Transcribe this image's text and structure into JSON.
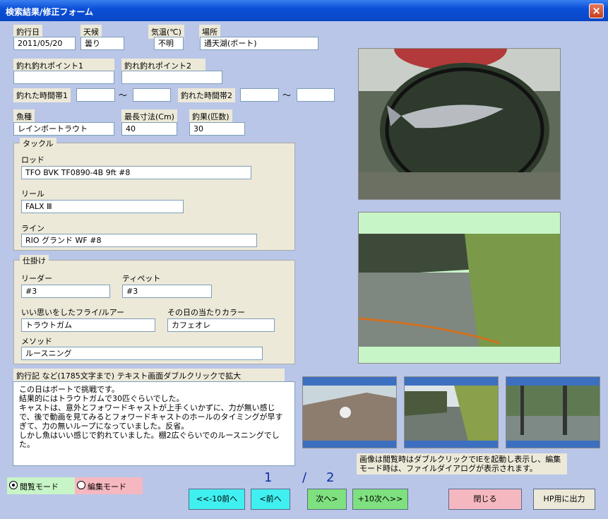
{
  "window": {
    "title": "検索結果/修正フォーム",
    "close_label": "×"
  },
  "fields": {
    "date": {
      "label": "釣行日",
      "value": "2011/05/20"
    },
    "weather": {
      "label": "天候",
      "value": "曇り"
    },
    "temp": {
      "label": "気温(℃)",
      "value": "不明"
    },
    "place": {
      "label": "場所",
      "value": "通天湖(ボート)"
    },
    "point1": {
      "label": "釣れ釣れポイント1",
      "value": ""
    },
    "point2": {
      "label": "釣れ釣れポイント2",
      "value": ""
    },
    "time1": {
      "label": "釣れた時間帯1",
      "from": "",
      "to": ""
    },
    "time2": {
      "label": "釣れた時間帯2",
      "from": "",
      "to": ""
    },
    "tilde": "～",
    "species": {
      "label": "魚種",
      "value": "レインボートラウト"
    },
    "maxsize": {
      "label": "最長寸法(Cm)",
      "value": "40"
    },
    "catch": {
      "label": "釣果(匹数)",
      "value": "30"
    }
  },
  "tackle": {
    "label": "タックル",
    "rod": {
      "label": "ロッド",
      "value": "TFO BVK TF0890-4B 9ft #8"
    },
    "reel": {
      "label": "リール",
      "value": "FALX Ⅲ"
    },
    "line": {
      "label": "ライン",
      "value": "RIO グランド WF #8"
    }
  },
  "rig": {
    "label": "仕掛け",
    "leader": {
      "label": "リーダー",
      "value": "#3"
    },
    "tippet": {
      "label": "ティペット",
      "value": "#3"
    },
    "fly": {
      "label": "いい思いをしたフライ/ルアー",
      "value": "トラウトガム"
    },
    "color": {
      "label": "その日の当たりカラー",
      "value": "カフェオレ"
    },
    "method": {
      "label": "メソッド",
      "value": "ルースニング"
    }
  },
  "journal": {
    "label": "釣行記 など(1785文字まで) テキスト画面ダブルクリックで拡大",
    "text": "この日はボートで挑戦です。\n結果的にはトラウトガムで30匹ぐらいでした。\nキャストは、意外とフォワードキャストが上手くいかずに、力が無い感じで、後で動画を見てみるとフォワードキャストのホールのタイミングが早すぎて、力の無いループになっていました。反省。\nしかし魚はいい感じで釣れていました。棚2広ぐらいでのルースニングでした。"
  },
  "image_note": "画像は閲覧時はダブルクリックでIEを起動し表示し、編集モード時は、ファイルダイアログが表示されます。",
  "modes": {
    "view": "閲覧モード",
    "edit": "編集モード"
  },
  "pager": {
    "current": "1",
    "sep": "/",
    "total": "2"
  },
  "buttons": {
    "back10": "<<-10前へ",
    "back": "<前へ",
    "next": "次へ>",
    "next10": "+10次へ>>",
    "close": "閉じる",
    "export": "HP用に出力"
  },
  "colors": {
    "title": "#0b50d8",
    "bg": "#b9c6e8",
    "label": "#ece9d8",
    "btn_cyan": "#40f0f0",
    "btn_green": "#7ee07e",
    "btn_pink": "#f6b8c0"
  }
}
